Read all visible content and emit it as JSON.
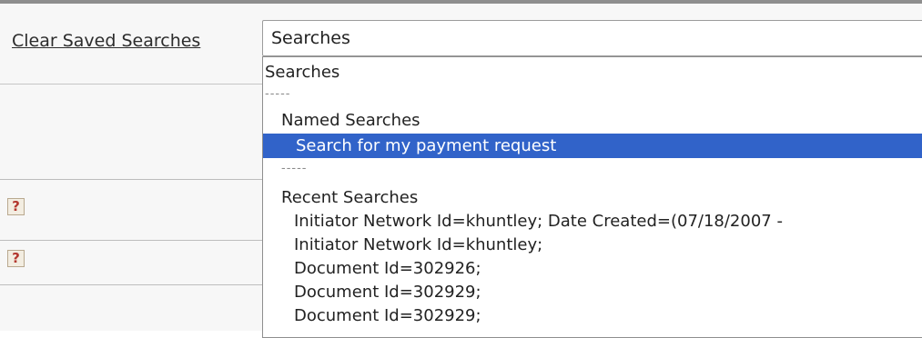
{
  "toolbar": {
    "clear_saved_searches": "Clear Saved Searches"
  },
  "help": {
    "icon_glyph": "?"
  },
  "search_select": {
    "selected_value": "Searches",
    "options": [
      {
        "label": "Searches",
        "kind": "option"
      },
      {
        "label": "-----",
        "kind": "separator"
      },
      {
        "label": "Named Searches",
        "kind": "group"
      },
      {
        "label": "Search for my payment request",
        "kind": "option",
        "selected": true
      },
      {
        "label": "-----",
        "kind": "separator"
      },
      {
        "label": "Recent Searches",
        "kind": "group"
      },
      {
        "label": "Initiator Network Id=khuntley; Date Created=(07/18/2007 -",
        "kind": "option"
      },
      {
        "label": "Initiator Network Id=khuntley;",
        "kind": "option"
      },
      {
        "label": "Document Id=302926;",
        "kind": "option"
      },
      {
        "label": "Document Id=302929;",
        "kind": "option"
      },
      {
        "label": "Document Id=302929;",
        "kind": "option"
      }
    ]
  },
  "colors": {
    "selection": "#3163c9",
    "help_icon": "#b3382f"
  }
}
